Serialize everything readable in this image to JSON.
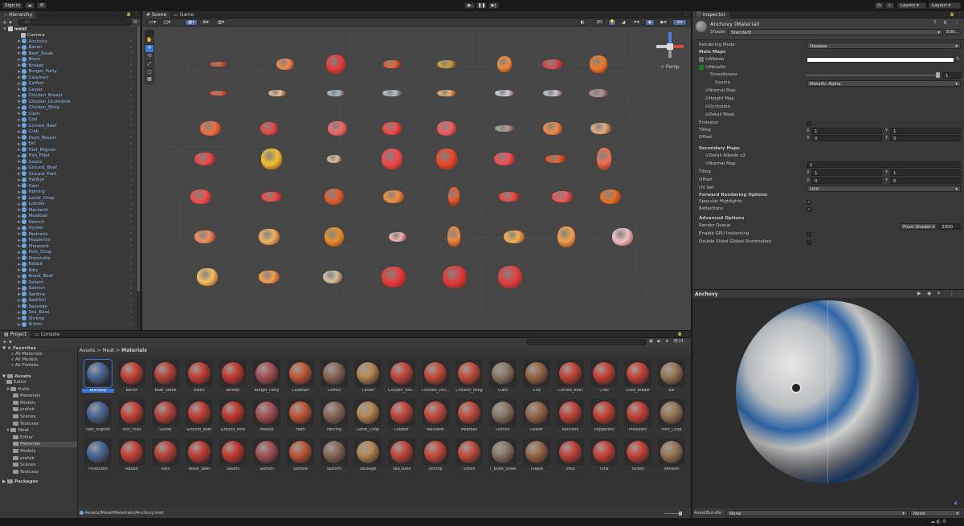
{
  "toolbar": {
    "sign_in": "Sign in",
    "layers": "Layers",
    "layout": "Layout"
  },
  "hierarchy": {
    "tab": "Hierarchy",
    "search_placeholder": "All",
    "scene": "meat",
    "items": [
      "Camera",
      "Anchovy",
      "Bacon",
      "Beef_Steak",
      "Bison",
      "Brisket",
      "Burger_Patty",
      "Calamari",
      "Catfish",
      "Caviar",
      "Chicken_Breast",
      "Chicken_Drumstick",
      "Chicken_Wing",
      "Clam",
      "Cod",
      "Corned_Beef",
      "Crab",
      "Duck_Breast",
      "Eel",
      "Filet_Mignon",
      "Fish_Fillet",
      "Goose",
      "Ground_Beef",
      "Ground_Pork",
      "Halibut",
      "Ham",
      "Herring",
      "Lamb_Chop",
      "Lobster",
      "Mackerel",
      "Meatball",
      "Ostrich",
      "Oyster",
      "Pastrami",
      "Pepperoni",
      "Pheasant",
      "Pork_Chop",
      "Prosciutto",
      "Rabbit",
      "Ribs",
      "Roast_Beef",
      "Salami",
      "Salmon",
      "Sardine",
      "Sashimi",
      "Sausage",
      "Sea_Bass",
      "Shrimp",
      "Sirloin"
    ]
  },
  "scene": {
    "tabs": [
      "Scene",
      "Game"
    ],
    "persp": "< Persp",
    "zoom": "20"
  },
  "inspector": {
    "tab": "Inspector",
    "title": "Anchovy (Material)",
    "shader_label": "Shader",
    "shader_value": "Standard",
    "edit": "Edit...",
    "rendering_mode_label": "Rendering Mode",
    "rendering_mode_value": "Opaque",
    "main_maps": "Main Maps",
    "albedo": "Albedo",
    "metallic": "Metallic",
    "smoothness": "Smoothness",
    "smoothness_value": "1",
    "source": "Source",
    "source_value": "Metallic Alpha",
    "normal_map": "Normal Map",
    "height_map": "Height Map",
    "occlusion": "Occlusion",
    "detail_mask": "Detail Mask",
    "emission": "Emission",
    "tiling": "Tiling",
    "offset": "Offset",
    "tiling_x": "1",
    "tiling_y": "1",
    "offset_x": "0",
    "offset_y": "0",
    "secondary_maps": "Secondary Maps",
    "detail_albedo": "Detail Albedo x2",
    "normal_map2": "Normal Map",
    "normal_map2_value": "1",
    "tiling2_x": "1",
    "tiling2_y": "1",
    "offset2_x": "0",
    "offset2_y": "0",
    "uv_set": "UV Set",
    "uv_set_value": "UV0",
    "forward_options": "Forward Rendering Options",
    "specular": "Specular Highlights",
    "reflections": "Reflections",
    "advanced": "Advanced Options",
    "render_queue": "Render Queue",
    "render_queue_mode": "From Shader",
    "render_queue_value": "2000",
    "gpu_instancing": "Enable GPU Instancing",
    "double_sided": "Double Sided Global Illumination",
    "preview_title": "Anchovy",
    "assetbundle_label": "AssetBundle",
    "assetbundle_value": "None",
    "assetbundle_variant": "None",
    "x_label": "X",
    "y_label": "Y"
  },
  "project": {
    "tabs": [
      "Project",
      "Console"
    ],
    "favorites": "Favorites",
    "fav_items": [
      "All Materials",
      "All Models",
      "All Prefabs"
    ],
    "assets": "Assets",
    "tree": [
      {
        "label": "Editor",
        "depth": 1
      },
      {
        "label": "fruits",
        "depth": 1
      },
      {
        "label": "Materials",
        "depth": 2
      },
      {
        "label": "Models",
        "depth": 2
      },
      {
        "label": "prefab",
        "depth": 2
      },
      {
        "label": "Scenes",
        "depth": 2
      },
      {
        "label": "Textures",
        "depth": 2
      },
      {
        "label": "Meat",
        "depth": 1
      },
      {
        "label": "Editor",
        "depth": 2
      },
      {
        "label": "Materials",
        "depth": 2
      },
      {
        "label": "Models",
        "depth": 2
      },
      {
        "label": "prefab",
        "depth": 2
      },
      {
        "label": "Scenes",
        "depth": 2
      },
      {
        "label": "Textures",
        "depth": 2
      }
    ],
    "packages": "Packages",
    "breadcrumb": [
      "Assets",
      "Meat",
      "Materials"
    ],
    "count": "14",
    "path": "Assets/Meat/Materials/Anchovy.mat",
    "materials": [
      "Anchovy",
      "Bacon",
      "Beef_Steak",
      "Bison",
      "Brisket",
      "Burger_Patty",
      "Calamari",
      "Catfish",
      "Caviar",
      "Chicken_Bre...",
      "Chicken_Dru...",
      "Chicken_Wing",
      "Clam",
      "Cod",
      "Corned_Beef",
      "Crab",
      "Duck_Breast",
      "Eel",
      "Filet_Mignon",
      "Fish_Fillet",
      "Goose",
      "Ground_Beef",
      "Ground_Pork",
      "Halibut",
      "Ham",
      "Herring",
      "Lamb_Chop",
      "Lobster",
      "Mackerel",
      "Meatball",
      "Ostrich",
      "Oyster",
      "Pastrami",
      "Pepperoni",
      "Pheasant",
      "Pork_Chop",
      "Prosciutto",
      "Rabbit",
      "Ribs",
      "Roast_Beef",
      "Salami",
      "Salmon",
      "Sardine",
      "Sashimi",
      "Sausage",
      "Sea_Bass",
      "Shrimp",
      "Sirloin",
      "T_Bone_Steak",
      "Tilapia",
      "Trout",
      "Tuna",
      "Turkey",
      "Venison"
    ]
  },
  "colors": {
    "accent": "#3a79d8",
    "hierarchy_text": "#8fbef5"
  }
}
